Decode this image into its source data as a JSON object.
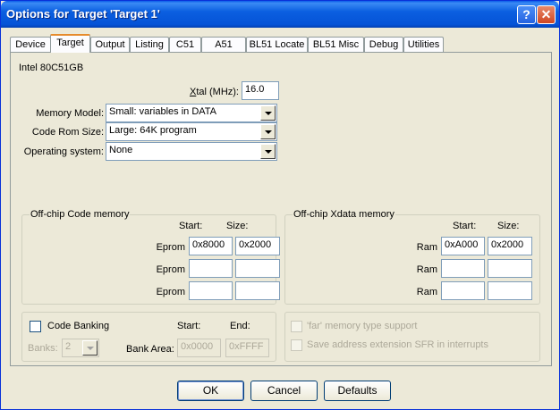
{
  "window": {
    "title": "Options for Target 'Target 1'",
    "help_label": "?",
    "close_label": "✕"
  },
  "tabs": [
    {
      "label": "Device"
    },
    {
      "label": "Target"
    },
    {
      "label": "Output"
    },
    {
      "label": "Listing"
    },
    {
      "label": "C51"
    },
    {
      "label": "A51"
    },
    {
      "label": "BL51 Locate"
    },
    {
      "label": "BL51 Misc"
    },
    {
      "label": "Debug"
    },
    {
      "label": "Utilities"
    }
  ],
  "device_name": "Intel 80C51GB",
  "xtal": {
    "label_pre": "X",
    "label_post": "tal (MHz):",
    "value": "16.0"
  },
  "memory_model": {
    "label": "Memory Model:",
    "value": "Small: variables in DATA"
  },
  "code_rom_size": {
    "label": "Code Rom Size:",
    "value": "Large: 64K program"
  },
  "operating_system": {
    "label": "Operating system:",
    "value": "None"
  },
  "offchip_code": {
    "title": "Off-chip Code memory",
    "start_header": "Start:",
    "size_header": "Size:",
    "rows": [
      {
        "label": "Eprom",
        "start": "0x8000",
        "size": "0x2000"
      },
      {
        "label": "Eprom",
        "start": "",
        "size": ""
      },
      {
        "label": "Eprom",
        "start": "",
        "size": ""
      }
    ]
  },
  "offchip_xdata": {
    "title": "Off-chip Xdata memory",
    "start_header": "Start:",
    "size_header": "Size:",
    "rows": [
      {
        "label": "Ram",
        "start": "0xA000",
        "size": "0x2000"
      },
      {
        "label": "Ram",
        "start": "",
        "size": ""
      },
      {
        "label": "Ram",
        "start": "",
        "size": ""
      }
    ]
  },
  "code_banking": {
    "label": "Code Banking",
    "checked": false,
    "banks_label": "Banks:",
    "banks_value": "2",
    "bank_area_label": "Bank Area:",
    "start_header": "Start:",
    "end_header": "End:",
    "start_value": "0x0000",
    "end_value": "0xFFFF"
  },
  "far_memory": {
    "label": "'far' memory type support",
    "checked": false
  },
  "save_address": {
    "label": "Save address extension SFR in interrupts",
    "checked": false
  },
  "buttons": {
    "ok": "OK",
    "cancel": "Cancel",
    "defaults": "Defaults"
  }
}
